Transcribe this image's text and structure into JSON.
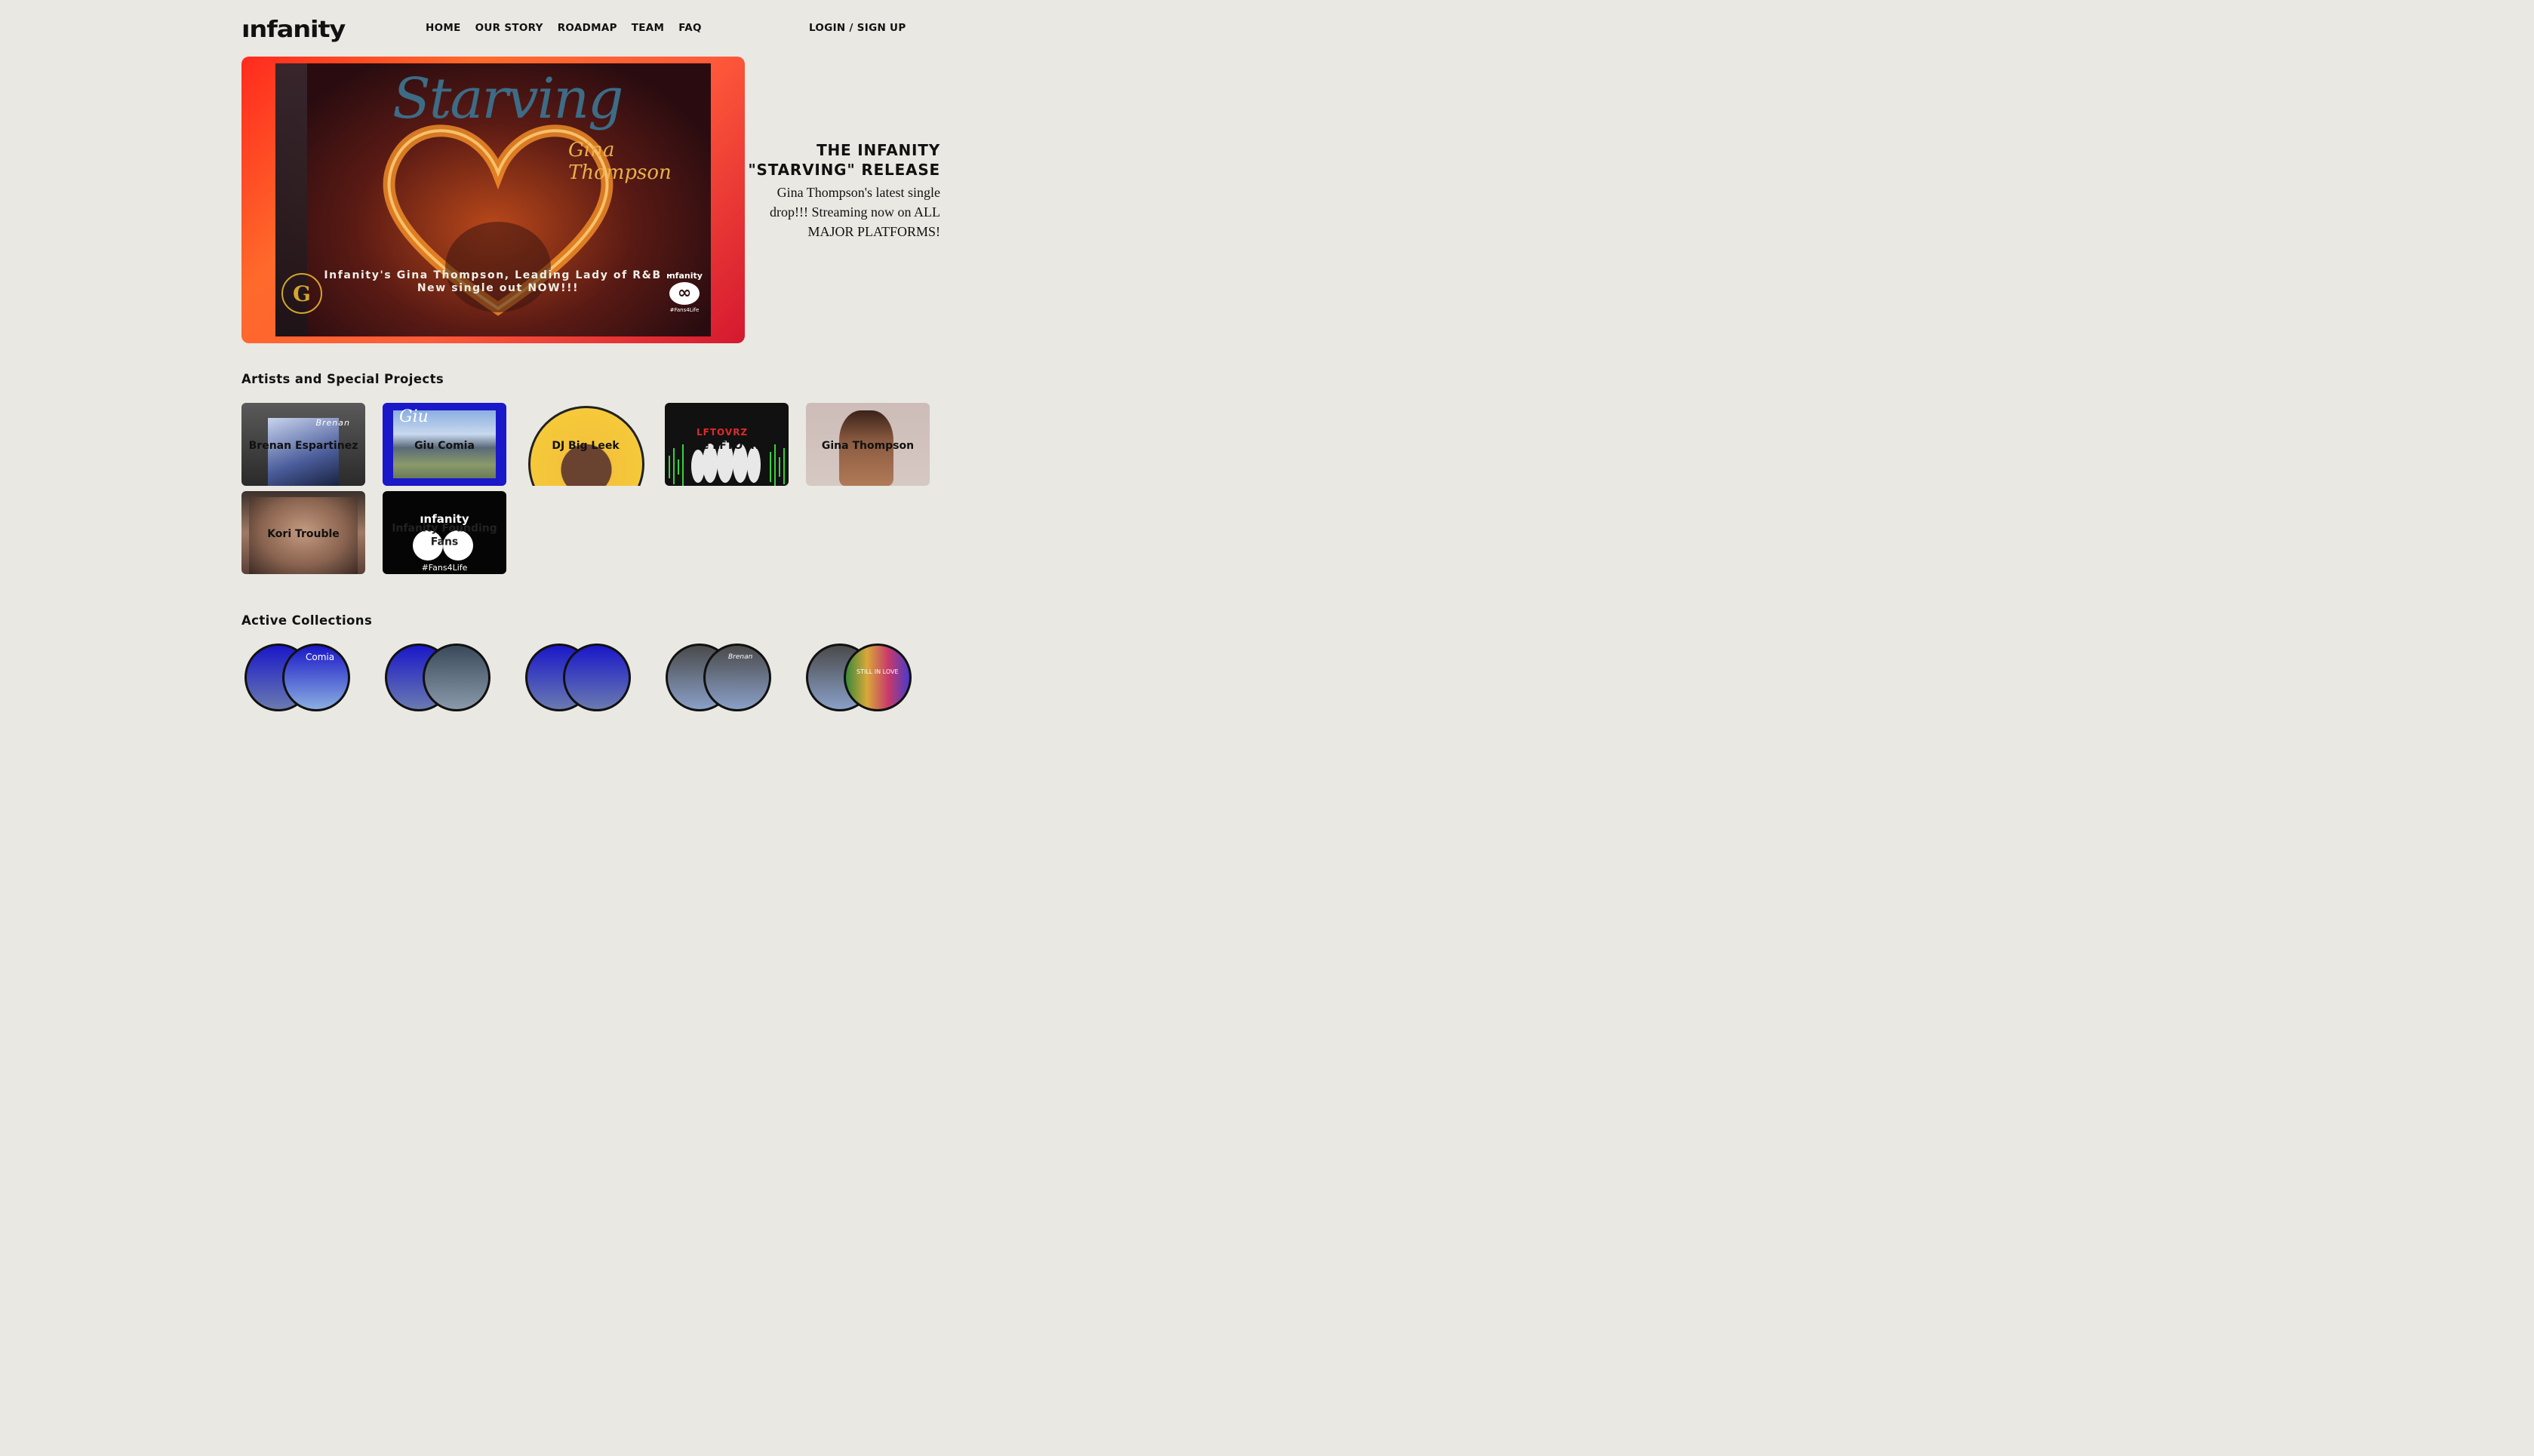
{
  "header": {
    "logo": "ınfanity",
    "nav": [
      "HOME",
      "OUR STORY",
      "ROADMAP",
      "TEAM",
      "FAQ"
    ],
    "login": "LOGIN / SIGN UP"
  },
  "hero": {
    "poster": {
      "title": "Starving",
      "artist": "Gina Thompson",
      "caption_line1": "Infanity's Gina Thompson, Leading Lady of R&B -",
      "caption_line2": "New single out NOW!!!",
      "seal": "G",
      "brand": "ınfanity",
      "brand_tag": "#Fans4Life"
    },
    "title": "THE INFANITY \"STARVING\" RELEASE",
    "description": "Gina Thompson's latest single drop!!! Streaming now on ALL MAJOR PLATFORMS!"
  },
  "artists": {
    "heading": "Artists and Special Projects",
    "items": [
      {
        "name": "Brenan Espartinez",
        "overlay": "Brenan"
      },
      {
        "name": "Giu Comia",
        "overlay": "Giu"
      },
      {
        "name": "DJ Big Leek"
      },
      {
        "name": "The LFTOVRZ",
        "overlay": "LFTOVRZ"
      },
      {
        "name": "Gina Thompson"
      },
      {
        "name": "Kori Trouble"
      },
      {
        "name": "Infanity Founding Fans",
        "logo": "ınfanity",
        "tag": "#Fans4Life"
      }
    ]
  },
  "collections": {
    "heading": "Active Collections",
    "overlays": [
      "Comia",
      "Brenan",
      "STILL IN LOVE"
    ]
  },
  "colors": {
    "background": "#e9e8e2",
    "hero_gradient": [
      "#ff2a1e",
      "#d41830"
    ]
  }
}
